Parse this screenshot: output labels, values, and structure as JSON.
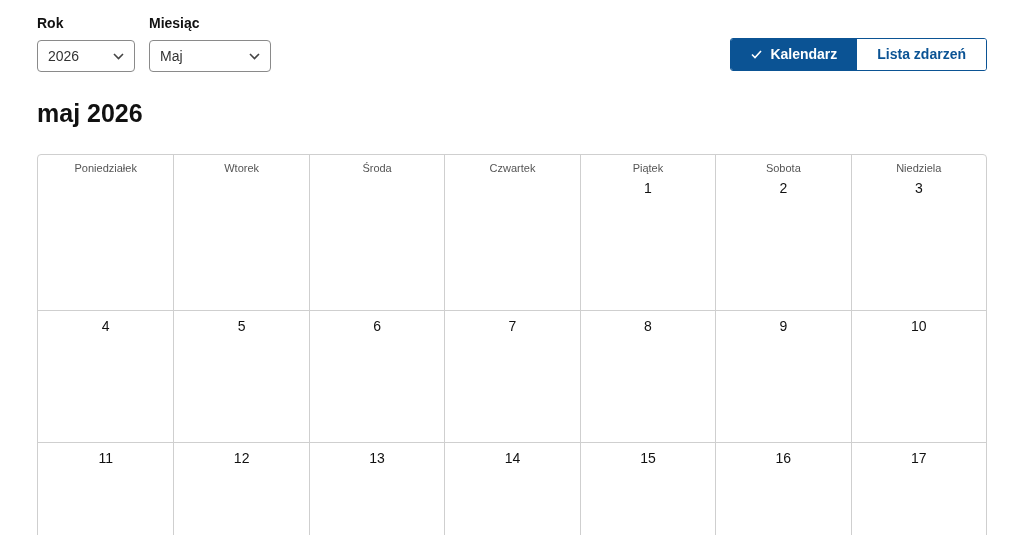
{
  "filters": [
    {
      "label": "Rok",
      "value": "2026"
    },
    {
      "label": "Miesiąc",
      "value": "Maj"
    }
  ],
  "view_toggle": [
    {
      "label": "Kalendarz",
      "selected": true
    },
    {
      "label": "Lista zdarzeń",
      "selected": false
    }
  ],
  "title": "maj 2026",
  "weekdays": [
    "Poniedziałek",
    "Wtorek",
    "Środa",
    "Czwartek",
    "Piątek",
    "Sobota",
    "Niedziela"
  ],
  "weeks": [
    [
      {
        "kind": "blank"
      },
      {
        "kind": "blank"
      },
      {
        "kind": "blank"
      },
      {
        "kind": "blank"
      },
      {
        "kind": "day",
        "day": "1"
      },
      {
        "kind": "day",
        "day": "2"
      },
      {
        "kind": "day",
        "day": "3"
      }
    ],
    [
      {
        "kind": "day",
        "day": "4"
      },
      {
        "kind": "day",
        "day": "5"
      },
      {
        "kind": "day",
        "day": "6"
      },
      {
        "kind": "day",
        "day": "7"
      },
      {
        "kind": "day",
        "day": "8"
      },
      {
        "kind": "day",
        "day": "9"
      },
      {
        "kind": "day",
        "day": "10"
      }
    ],
    [
      {
        "kind": "day",
        "day": "11"
      },
      {
        "kind": "day",
        "day": "12"
      },
      {
        "kind": "day",
        "day": "13"
      },
      {
        "kind": "day",
        "day": "14"
      },
      {
        "kind": "day",
        "day": "15"
      },
      {
        "kind": "day",
        "day": "16"
      },
      {
        "kind": "day",
        "day": "17"
      }
    ]
  ]
}
